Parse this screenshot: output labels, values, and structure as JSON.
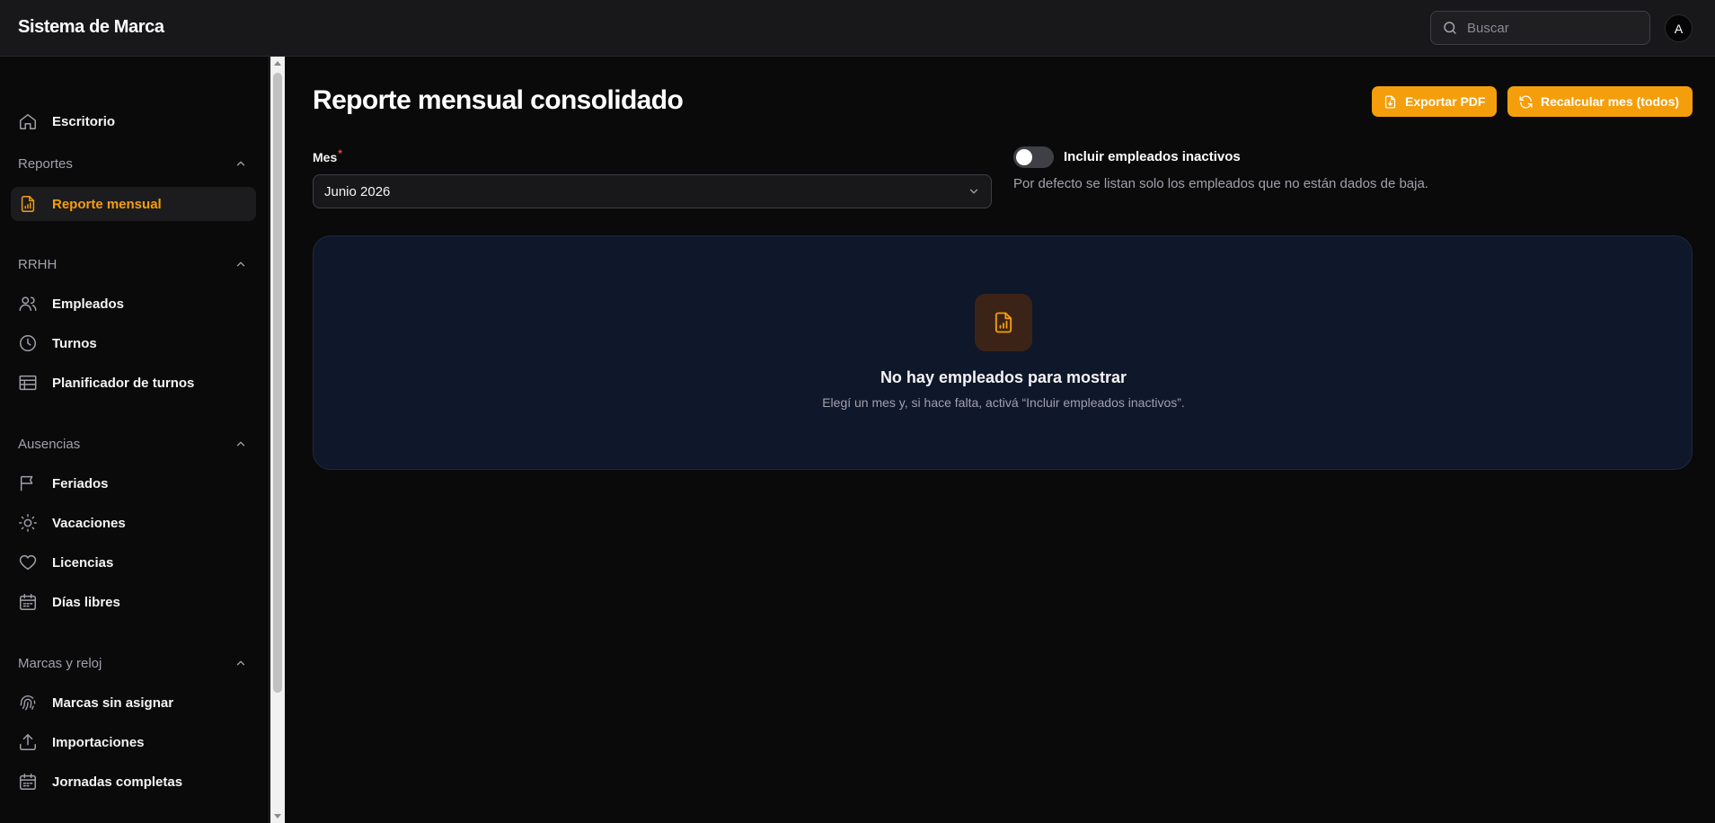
{
  "app": {
    "title": "Sistema de Marca"
  },
  "header": {
    "search_placeholder": "Buscar",
    "avatar_initial": "A"
  },
  "sidebar": {
    "top_item": {
      "label": "Escritorio",
      "icon": "home-icon"
    },
    "groups": [
      {
        "title": "Reportes",
        "items": [
          {
            "label": "Reporte mensual",
            "icon": "file-chart-icon",
            "active": true
          }
        ]
      },
      {
        "title": "RRHH",
        "items": [
          {
            "label": "Empleados",
            "icon": "users-icon"
          },
          {
            "label": "Turnos",
            "icon": "clock-icon"
          },
          {
            "label": "Planificador de turnos",
            "icon": "table-icon"
          }
        ]
      },
      {
        "title": "Ausencias",
        "items": [
          {
            "label": "Feriados",
            "icon": "flag-icon"
          },
          {
            "label": "Vacaciones",
            "icon": "sun-icon"
          },
          {
            "label": "Licencias",
            "icon": "heart-icon"
          },
          {
            "label": "Días libres",
            "icon": "calendar-icon"
          }
        ]
      },
      {
        "title": "Marcas y reloj",
        "items": [
          {
            "label": "Marcas sin asignar",
            "icon": "fingerprint-icon"
          },
          {
            "label": "Importaciones",
            "icon": "upload-icon"
          },
          {
            "label": "Jornadas completas",
            "icon": "calendar-check-icon"
          }
        ]
      }
    ]
  },
  "main": {
    "title": "Reporte mensual consolidado",
    "actions": {
      "export_label": "Exportar PDF",
      "recalc_label": "Recalcular mes (todos)"
    },
    "month_field": {
      "label": "Mes",
      "required_mark": "*",
      "value": "Junio 2026"
    },
    "inactive_toggle": {
      "label": "Incluir empleados inactivos",
      "enabled": false,
      "help": "Por defecto se listan solo los empleados que no están dados de baja."
    },
    "empty_state": {
      "title": "No hay empleados para mostrar",
      "description": "Elegí un mes y, si hace falta, activá “Incluir empleados inactivos”."
    }
  },
  "colors": {
    "accent": "#f59e0b",
    "background": "#0a0a0b",
    "card": "#0f172a"
  }
}
